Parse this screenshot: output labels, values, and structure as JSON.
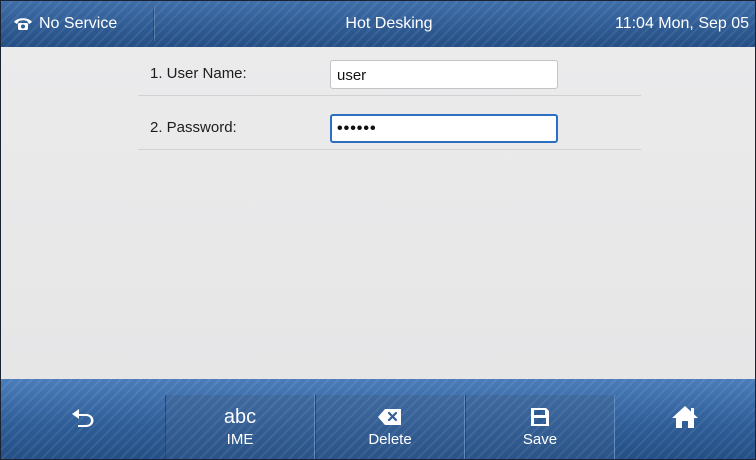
{
  "topbar": {
    "status": "No Service",
    "status_icon": "phone-icon",
    "title": "Hot Desking",
    "clock": "11:04 Mon, Sep 05"
  },
  "form": {
    "fields": [
      {
        "label": "1. User Name:",
        "value": "user",
        "focused": false
      },
      {
        "label": "2. Password:",
        "value": "••••••",
        "focused": true
      }
    ]
  },
  "softkeys": {
    "ime": {
      "glyph": "abc",
      "label": "IME"
    },
    "delete": {
      "icon": "backspace-icon",
      "label": "Delete"
    },
    "save": {
      "icon": "floppy-disk-icon",
      "label": "Save"
    }
  },
  "nav": {
    "back_icon": "back-arrow-icon",
    "home_icon": "home-icon"
  },
  "colors": {
    "bar_blue": "#2e5a92",
    "focus_border": "#2b6fc2",
    "content_bg": "#e9e9ea"
  }
}
